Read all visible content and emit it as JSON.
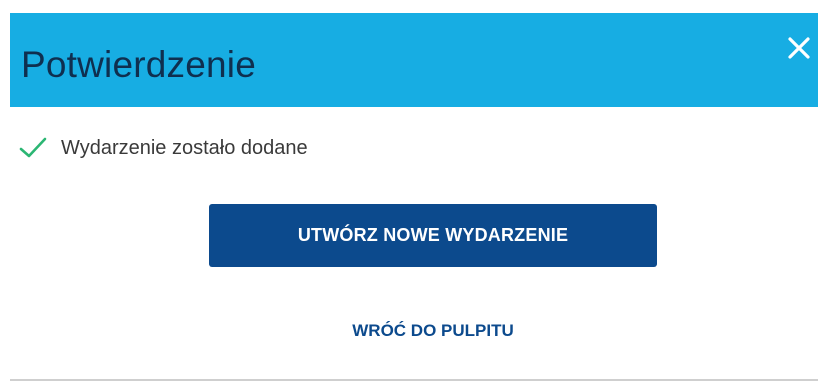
{
  "dialog": {
    "title": "Potwierdzenie",
    "close_icon": "close-icon",
    "header_color": "#17ade3"
  },
  "message": {
    "icon": "check-icon",
    "icon_color": "#2bb673",
    "text": "Wydarzenie zostało dodane"
  },
  "actions": {
    "primary_label": "UTWÓRZ NOWE WYDARZENIE",
    "primary_color": "#0c4a8d",
    "secondary_label": "WRÓĆ DO PULPITU"
  }
}
